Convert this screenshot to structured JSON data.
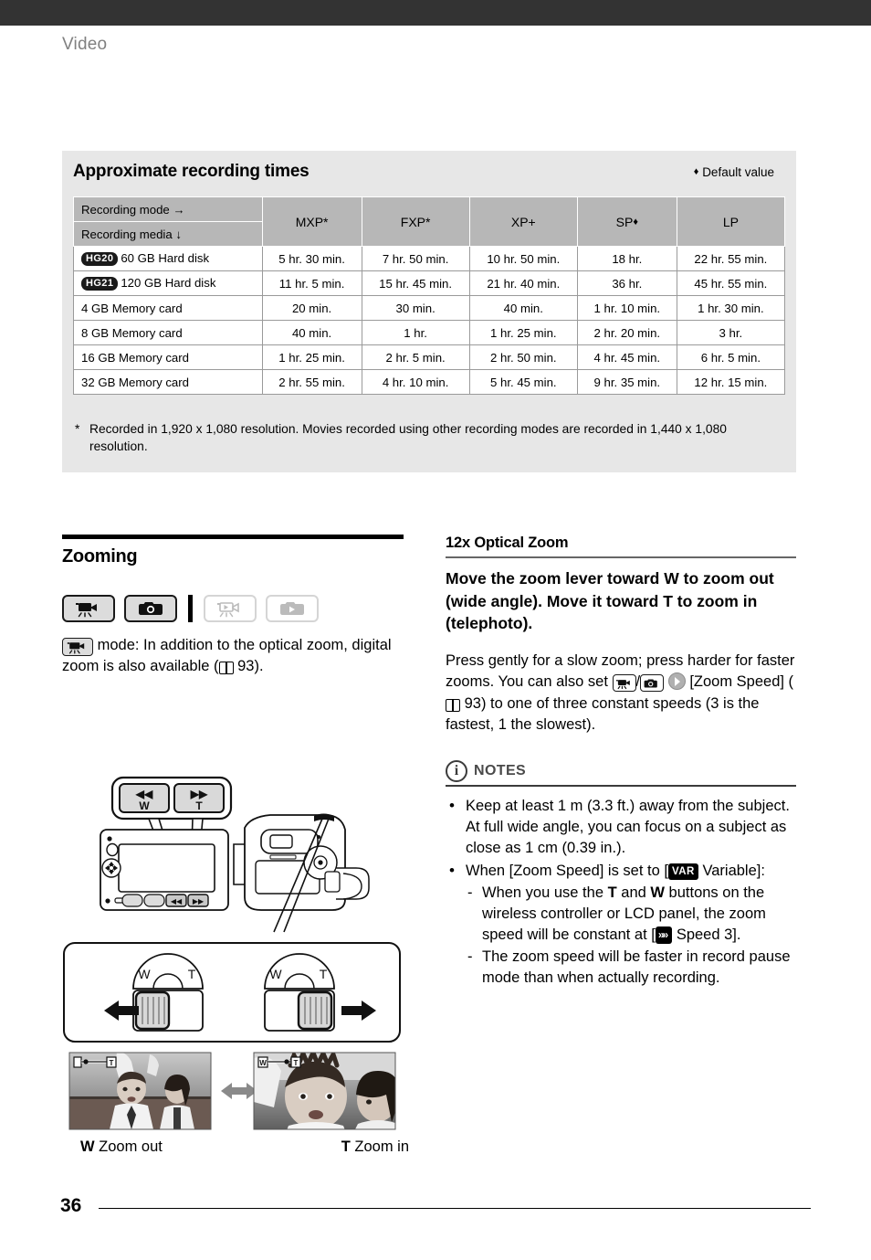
{
  "header": {
    "running_head": "Video"
  },
  "footer": {
    "page_number": "36"
  },
  "table_section": {
    "title": "Approximate recording times",
    "default_value_note": "Default value",
    "diamond_glyph": "♦",
    "header_mode_label": "Recording mode →",
    "header_media_label": "Recording media ↓",
    "columns": [
      "MXP*",
      "FXP*",
      "XP+",
      "SP",
      "LP"
    ],
    "sp_has_diamond": true,
    "rows": [
      {
        "badge": "HG20",
        "media": "60 GB Hard disk",
        "values": [
          "5 hr. 30 min.",
          "7 hr. 50 min.",
          "10 hr. 50 min.",
          "18 hr.",
          "22 hr. 55 min."
        ]
      },
      {
        "badge": "HG21",
        "media": "120 GB Hard disk",
        "values": [
          "11 hr. 5 min.",
          "15 hr. 45 min.",
          "21 hr. 40 min.",
          "36 hr.",
          "45 hr. 55 min."
        ]
      },
      {
        "badge": "",
        "media": "4 GB Memory card",
        "values": [
          "20 min.",
          "30 min.",
          "40 min.",
          "1 hr. 10 min.",
          "1 hr. 30 min."
        ]
      },
      {
        "badge": "",
        "media": "8 GB Memory card",
        "values": [
          "40 min.",
          "1 hr.",
          "1 hr. 25 min.",
          "2 hr. 20 min.",
          "3 hr."
        ]
      },
      {
        "badge": "",
        "media": "16 GB Memory card",
        "values": [
          "1 hr. 25 min.",
          "2 hr. 5 min.",
          "2 hr. 50 min.",
          "4 hr. 45 min.",
          "6 hr. 5 min."
        ]
      },
      {
        "badge": "",
        "media": "32 GB Memory card",
        "values": [
          "2 hr. 55 min.",
          "4 hr. 10 min.",
          "5 hr. 45 min.",
          "9 hr. 35 min.",
          "12 hr. 15 min."
        ]
      }
    ],
    "footnote_marker": "*",
    "footnote": "Recorded in 1,920 x 1,080 resolution. Movies recorded using other recording modes are recorded in 1,440 x 1,080 resolution."
  },
  "left_column": {
    "section_title": "Zooming",
    "mode_icons": [
      {
        "name": "movie-camera-icon",
        "state": "active"
      },
      {
        "name": "photo-camera-icon",
        "state": "active"
      },
      {
        "name": "movie-playback-icon",
        "state": "inactive"
      },
      {
        "name": "photo-playback-icon",
        "state": "inactive"
      }
    ],
    "mode_paragraph_pre": "mode: In addition to the optical zoom, digital zoom is also available (",
    "mode_paragraph_page": "93",
    "mode_paragraph_post": ").",
    "callout_buttons": [
      {
        "arrow": "◀◀",
        "label": "W"
      },
      {
        "arrow": "▶▶",
        "label": "T"
      }
    ],
    "lever_labels": {
      "wide": "W",
      "tele": "T"
    },
    "photo_captions": [
      {
        "letter": "W",
        "text": "Zoom out"
      },
      {
        "letter": "T",
        "text": "Zoom in"
      }
    ]
  },
  "right_column": {
    "subsection_title": "12x Optical Zoom",
    "lead_part1": "Move the zoom lever toward ",
    "lead_w": "W",
    "lead_part2": " to zoom out (wide angle). Move it toward ",
    "lead_t": "T",
    "lead_part3": " to zoom in (telephoto).",
    "body_part1": "Press gently for a slow zoom; press harder for faster zooms. You can also set ",
    "body_slash": "/",
    "body_menu": "[Zoom Speed] (",
    "body_page": "93",
    "body_part2": ") to one of three constant speeds (3 is the fastest, 1 the slowest).",
    "notes_label": "NOTES",
    "notes_icon_glyph": "i",
    "notes": [
      {
        "text": "Keep at least 1 m (3.3 ft.) away from the subject. At full wide angle, you can focus on a subject as close as 1 cm (0.39 in.)."
      },
      {
        "text_pre": "When [Zoom Speed] is set to [",
        "badge": "VAR",
        "text_post": " Variable]:",
        "sub": [
          {
            "pre": "When you use the ",
            "b1": "T",
            "mid": " and ",
            "b2": "W",
            "post": " buttons on the wireless controller or LCD panel, the zoom speed will be constant at [",
            "speed_badge": "»»",
            "tail": " Speed 3]."
          },
          {
            "plain": "The zoom speed will be faster in record pause mode than when actually recording."
          }
        ]
      }
    ]
  },
  "colors": {
    "topbar": "#333333",
    "panel_bg": "#e7e7e7",
    "table_header_bg": "#b7b7b7",
    "running_head": "#808080"
  }
}
